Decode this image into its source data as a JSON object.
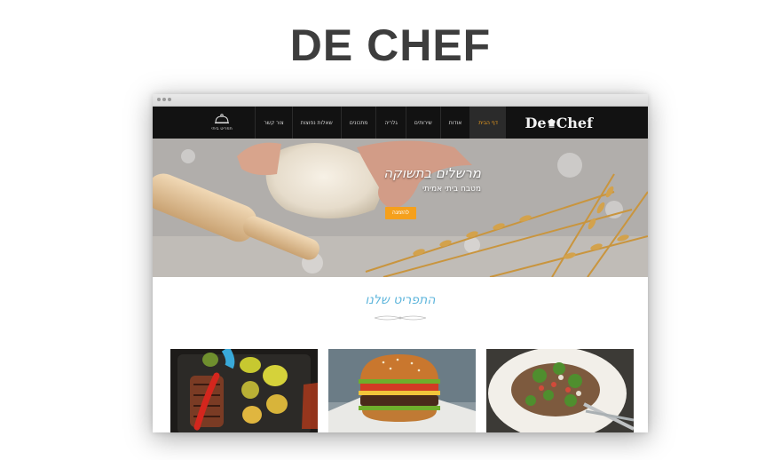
{
  "page": {
    "heading": "DE CHEF"
  },
  "navbar": {
    "menu_link_label": "תפריט ביתי",
    "items": [
      {
        "label": "דף הבית",
        "active": true
      },
      {
        "label": "אודות",
        "active": false
      },
      {
        "label": "שירותים",
        "active": false
      },
      {
        "label": "גלריה",
        "active": false
      },
      {
        "label": "מתכונים",
        "active": false
      },
      {
        "label": "שאלות נפוצות",
        "active": false
      },
      {
        "label": "צור קשר",
        "active": false
      }
    ],
    "logo": {
      "part1": "De",
      "part2": "Chef"
    }
  },
  "hero": {
    "title": "מרשלים בתשוקה",
    "subtitle": "מטבח ביתי אמיתי",
    "button_label": "להזמנה"
  },
  "section": {
    "title": "התפריט שלנו"
  },
  "cards": [
    {
      "name": "grilled-vegetables-photo"
    },
    {
      "name": "burger-photo"
    },
    {
      "name": "salad-photo"
    }
  ],
  "colors": {
    "accent": "#f5a01c",
    "section_title": "#5fb6dc",
    "nav_bg": "#121212"
  }
}
